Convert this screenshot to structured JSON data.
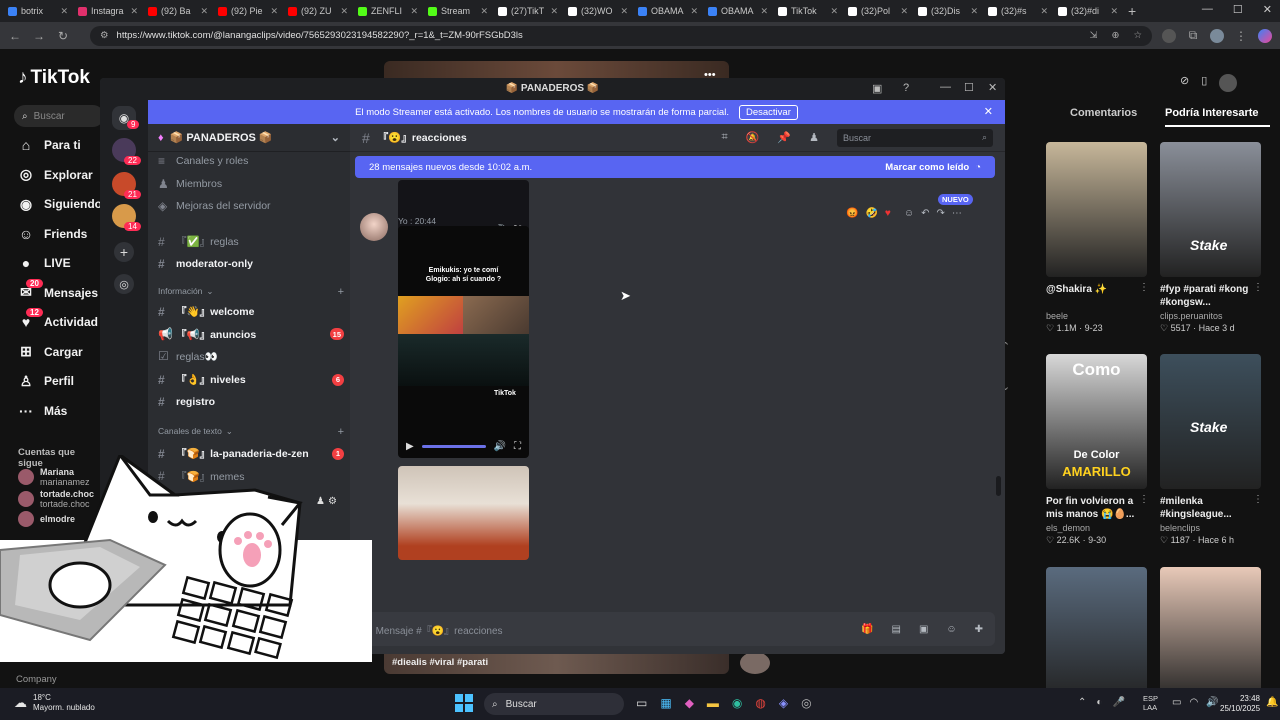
{
  "browser": {
    "tabs": [
      {
        "label": "botrix",
        "color": "#3b82f6"
      },
      {
        "label": "Instagra",
        "color": "#e1306c"
      },
      {
        "label": "(92) Ba",
        "color": "#ff0000"
      },
      {
        "label": "(92) Pie",
        "color": "#ff0000"
      },
      {
        "label": "(92) ZU",
        "color": "#ff0000"
      },
      {
        "label": "ZENFLI",
        "color": "#53fc18"
      },
      {
        "label": "Stream",
        "color": "#53fc18"
      },
      {
        "label": "(27)TikT",
        "color": "#ffffff"
      },
      {
        "label": "(32)WO",
        "color": "#ffffff"
      },
      {
        "label": "OBAMA",
        "color": "#3b82f6"
      },
      {
        "label": "OBAMA",
        "color": "#3b82f6"
      },
      {
        "label": "TikTok",
        "color": "#ffffff"
      },
      {
        "label": "(32)Pol",
        "color": "#ffffff"
      },
      {
        "label": "(32)Dis",
        "color": "#ffffff"
      },
      {
        "label": "(32)#s",
        "color": "#ffffff"
      },
      {
        "label": "(32)#di",
        "color": "#ffffff"
      }
    ],
    "url": "https://www.tiktok.com/@lanangaclips/video/7565293023194582290?_r=1&_t=ZM-90rFSGbD3ls"
  },
  "tiktok": {
    "logo": "TikTok",
    "search_placeholder": "Buscar",
    "nav": [
      {
        "label": "Para ti",
        "icon": "home-icon",
        "glyph": "⌂"
      },
      {
        "label": "Explorar",
        "icon": "compass-icon",
        "glyph": "◎"
      },
      {
        "label": "Siguiendo",
        "icon": "following-icon",
        "glyph": "◉"
      },
      {
        "label": "Friends",
        "icon": "friends-icon",
        "glyph": "☺"
      },
      {
        "label": "LIVE",
        "icon": "live-icon",
        "glyph": "●"
      },
      {
        "label": "Mensajes",
        "icon": "messages-icon",
        "glyph": "✉",
        "badge": "20"
      },
      {
        "label": "Actividad",
        "icon": "activity-icon",
        "glyph": "♥",
        "badge": "12"
      },
      {
        "label": "Cargar",
        "icon": "upload-icon",
        "glyph": "⊞"
      },
      {
        "label": "Perfil",
        "icon": "profile-icon",
        "glyph": "♙"
      },
      {
        "label": "Más",
        "icon": "more-icon",
        "glyph": "···"
      }
    ],
    "following_header": "Cuentas que sigue",
    "following": [
      {
        "name": "Mariana",
        "handle": "marianamez"
      },
      {
        "name": "tortade.choc",
        "handle": "tortade.choc"
      },
      {
        "name": "elmodre",
        "handle": ""
      }
    ],
    "company": "Company",
    "video_tags": "#diealis #viral #parati",
    "tabs": {
      "comments": "Comentarios",
      "related": "Podría Interesarte"
    },
    "cards": [
      {
        "caption": "@Shakira ✨",
        "author": "beele",
        "likes": "♡ 1.1M",
        "date": "9-23",
        "bg": "#c7b79a"
      },
      {
        "caption": "#fyp #parati #kong #kongsw...",
        "author": "clips.peruanitos",
        "likes": "♡ 5517",
        "date": "Hace 3 d",
        "bg": "#8a8f99"
      },
      {
        "caption": "Por fin volvieron a mis manos 😭🥚...",
        "author": "els_demon",
        "likes": "♡ 22.6K",
        "date": "9-30",
        "bg": "#d8d8d8"
      },
      {
        "caption": "#milenka #kingsleague...",
        "author": "belenclips",
        "likes": "♡ 1187",
        "date": "Hace 6 h",
        "bg": "#3d4f5c"
      },
      {
        "caption": "",
        "author": "",
        "likes": "",
        "date": "",
        "bg": "#5a6b7e"
      },
      {
        "caption": "",
        "author": "",
        "likes": "",
        "date": "",
        "bg": "#e8c9b8"
      }
    ],
    "card_texts": {
      "como": "Como",
      "de_color": "De Color",
      "amarillo": "AMARILLO",
      "stake": "Stake"
    }
  },
  "discord": {
    "title": "📦 PANADEROS 📦",
    "streamer_banner": "El modo Streamer está activado. Los nombres de usuario se mostrarán de forma parcial.",
    "deactivate_label": "Desactivar",
    "server_name": "📦 PANADEROS 📦",
    "server_badges": [
      "9",
      "22",
      "21",
      "14"
    ],
    "channels_top": [
      {
        "label": "Canales y roles",
        "icon": "≡"
      },
      {
        "label": "Miembros",
        "icon": "♟"
      },
      {
        "label": "Mejoras del servidor",
        "icon": "◈"
      }
    ],
    "channels_a": [
      {
        "label": "『✅』reglas",
        "type": "#",
        "bright": false,
        "count": ""
      },
      {
        "label": "moderator-only",
        "type": "#",
        "bright": true,
        "count": ""
      }
    ],
    "category_info": "Información",
    "channels_b": [
      {
        "label": "『👋』welcome",
        "type": "#",
        "bright": true,
        "count": ""
      },
      {
        "label": "『📢』anuncios",
        "type": "📢",
        "bright": true,
        "count": "15"
      },
      {
        "label": "reglas👀",
        "type": "☑",
        "bright": false,
        "count": ""
      },
      {
        "label": "『👌』niveles",
        "type": "#",
        "bright": true,
        "count": "6"
      },
      {
        "label": "registro",
        "type": "#",
        "bright": true,
        "count": ""
      }
    ],
    "category_text": "Canales de texto",
    "channels_c": [
      {
        "label": "『🍞』la-panaderia-de-zen",
        "type": "#",
        "bright": true,
        "count": "1"
      },
      {
        "label": "『🍞』memes",
        "type": "#",
        "bright": false,
        "count": ""
      },
      {
        "label": "『😮』reacciones",
        "type": "#",
        "bright": false,
        "count": ""
      }
    ],
    "channel_header": "『😮』reacciones",
    "search_placeholder": "Buscar",
    "new_messages": "28 mensajes nuevos desde 10:02 a.m.",
    "mark_read": "Marcar como leído",
    "message_author": "Yo",
    "message_time": "20:44",
    "new_badge": "NUEVO",
    "video_caption_top": "Emikukis: yo te comí",
    "video_caption_bottom": "Glogio: ah sí cuando ?",
    "video_watermark": "TikTok",
    "composer_placeholder": "Mensaje #『😮』reacciones"
  },
  "taskbar": {
    "weather_temp": "18°C",
    "weather_desc": "Mayorm. nublado",
    "search": "Buscar",
    "lang": "ESP",
    "lang2": "LAA",
    "time": "23:48",
    "date": "25/10/2025"
  }
}
